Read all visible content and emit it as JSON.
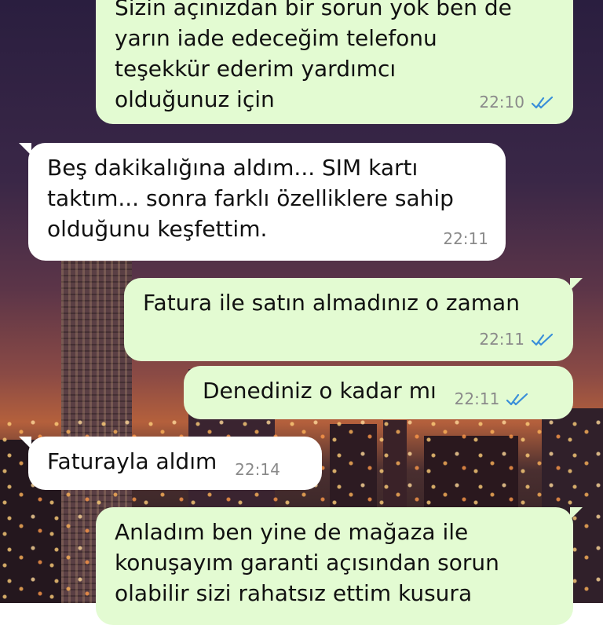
{
  "colors": {
    "outgoing_bubble": "#e3fbd2",
    "incoming_bubble": "#ffffff",
    "read_ticks": "#3a8fd9",
    "timestamp": "#8a8a8a"
  },
  "messages": [
    {
      "direction": "outgoing",
      "text": "Sizin açınızdan bir sorun yok ben de\nyarın iade edeceğim telefonu\nteşekkür ederim yardımcı\nolduğunuz için",
      "time": "22:10",
      "status_icon": "double-check-read-icon"
    },
    {
      "direction": "incoming",
      "text": "Beş dakikalığına aldım... SIM kartı\ntaktım... sonra farklı özelliklere sahip\nolduğunu keşfettim.",
      "time": "22:11"
    },
    {
      "direction": "outgoing",
      "text": "Fatura ile satın almadınız o zaman",
      "time": "22:11",
      "status_icon": "double-check-read-icon"
    },
    {
      "direction": "outgoing",
      "text": "Denediniz o kadar mı",
      "time": "22:11",
      "status_icon": "double-check-read-icon"
    },
    {
      "direction": "incoming",
      "text": "Faturayla aldım",
      "time": "22:14"
    },
    {
      "direction": "outgoing",
      "text": "Anladım ben yine de mağaza ile\nkonuşayım garanti açısından sorun\nolabilir sizi rahatsız ettim kusura",
      "time": "",
      "status_icon": ""
    }
  ]
}
